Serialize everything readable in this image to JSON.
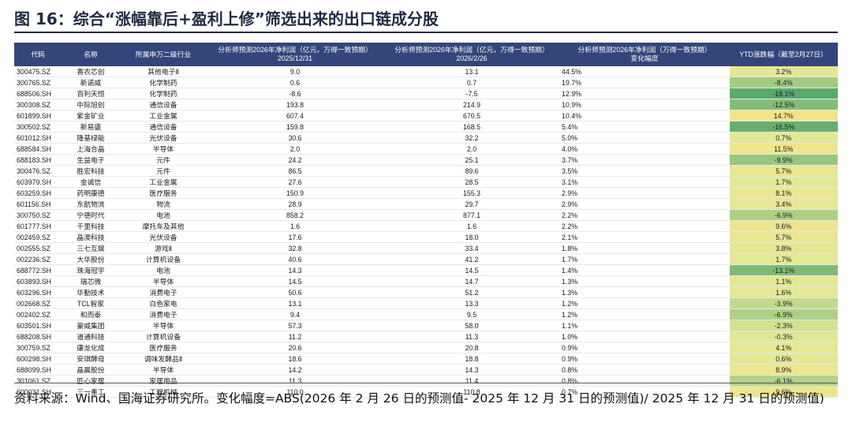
{
  "title": "图 16：综合“涨幅靠后+盈利上修”筛选出来的出口链成分股",
  "table": {
    "headers": {
      "code": "代码",
      "name": "名称",
      "industry": "所属申万二级行业",
      "np2026_1231": "分析师预测2026年净利润（亿元，万得一致预期）\n2025/12/31",
      "np2026_0226": "分析师预测2026年净利润（亿元，万得一致预期）\n2026/2/26",
      "change": "分析师预测2026年净利润（万得一致预期）\n变化幅度",
      "ytd": "YTD涨跌幅（截至2月27日）"
    },
    "rows": [
      {
        "code": "300475.SZ",
        "name": "香农芯创",
        "industry": "其他电子Ⅱ",
        "v1": "9.0",
        "v2": "13.1",
        "chg": "44.5%",
        "ytd": "3.2%",
        "ytd_val": 3.2
      },
      {
        "code": "300765.SZ",
        "name": "新诺威",
        "industry": "化学制药",
        "v1": "0.6",
        "v2": "0.7",
        "chg": "19.7%",
        "ytd": "-8.4%",
        "ytd_val": -8.4
      },
      {
        "code": "688506.SH",
        "name": "百利天恒",
        "industry": "化学制药",
        "v1": "-8.6",
        "v2": "-7.5",
        "chg": "12.9%",
        "ytd": "-18.1%",
        "ytd_val": -18.1
      },
      {
        "code": "300308.SZ",
        "name": "中际旭创",
        "industry": "通信设备",
        "v1": "193.8",
        "v2": "214.9",
        "chg": "10.9%",
        "ytd": "-12.5%",
        "ytd_val": -12.5
      },
      {
        "code": "601899.SH",
        "name": "紫金矿业",
        "industry": "工业金属",
        "v1": "607.4",
        "v2": "670.5",
        "chg": "10.4%",
        "ytd": "14.7%",
        "ytd_val": 14.7
      },
      {
        "code": "300502.SZ",
        "name": "新易盛",
        "industry": "通信设备",
        "v1": "159.8",
        "v2": "168.5",
        "chg": "5.4%",
        "ytd": "-16.5%",
        "ytd_val": -16.5
      },
      {
        "code": "601012.SH",
        "name": "隆基绿能",
        "industry": "光伏设备",
        "v1": "30.6",
        "v2": "32.2",
        "chg": "5.0%",
        "ytd": "0.7%",
        "ytd_val": 0.7
      },
      {
        "code": "688584.SH",
        "name": "上海合晶",
        "industry": "半导体",
        "v1": "2.0",
        "v2": "2.0",
        "chg": "4.0%",
        "ytd": "11.5%",
        "ytd_val": 11.5
      },
      {
        "code": "688183.SH",
        "name": "生益电子",
        "industry": "元件",
        "v1": "24.2",
        "v2": "25.1",
        "chg": "3.7%",
        "ytd": "-9.9%",
        "ytd_val": -9.9
      },
      {
        "code": "300476.SZ",
        "name": "胜宏科技",
        "industry": "元件",
        "v1": "86.5",
        "v2": "89.6",
        "chg": "3.5%",
        "ytd": "5.7%",
        "ytd_val": 5.7
      },
      {
        "code": "603979.SH",
        "name": "金诚信",
        "industry": "工业金属",
        "v1": "27.6",
        "v2": "28.5",
        "chg": "3.1%",
        "ytd": "1.7%",
        "ytd_val": 1.7
      },
      {
        "code": "603259.SH",
        "name": "药明康德",
        "industry": "医疗服务",
        "v1": "150.9",
        "v2": "155.3",
        "chg": "2.9%",
        "ytd": "8.1%",
        "ytd_val": 8.1
      },
      {
        "code": "601156.SH",
        "name": "东航物流",
        "industry": "物流",
        "v1": "28.9",
        "v2": "29.7",
        "chg": "2.9%",
        "ytd": "3.4%",
        "ytd_val": 3.4
      },
      {
        "code": "300750.SZ",
        "name": "宁德时代",
        "industry": "电池",
        "v1": "858.2",
        "v2": "877.1",
        "chg": "2.2%",
        "ytd": "-6.9%",
        "ytd_val": -6.9
      },
      {
        "code": "601777.SH",
        "name": "千里科技",
        "industry": "摩托车及其他",
        "v1": "1.6",
        "v2": "1.6",
        "chg": "2.2%",
        "ytd": "9.6%",
        "ytd_val": 9.6
      },
      {
        "code": "002459.SZ",
        "name": "晶澳科技",
        "industry": "光伏设备",
        "v1": "17.6",
        "v2": "18.0",
        "chg": "2.1%",
        "ytd": "5.7%",
        "ytd_val": 5.7
      },
      {
        "code": "002555.SZ",
        "name": "三七互娱",
        "industry": "游戏Ⅱ",
        "v1": "32.8",
        "v2": "33.4",
        "chg": "1.8%",
        "ytd": "3.8%",
        "ytd_val": 3.8
      },
      {
        "code": "002236.SZ",
        "name": "大华股份",
        "industry": "计算机设备",
        "v1": "40.6",
        "v2": "41.2",
        "chg": "1.7%",
        "ytd": "1.7%",
        "ytd_val": 1.7
      },
      {
        "code": "688772.SH",
        "name": "珠海冠宇",
        "industry": "电池",
        "v1": "14.3",
        "v2": "14.5",
        "chg": "1.4%",
        "ytd": "-13.1%",
        "ytd_val": -13.1
      },
      {
        "code": "603893.SH",
        "name": "瑞芯微",
        "industry": "半导体",
        "v1": "14.5",
        "v2": "14.7",
        "chg": "1.3%",
        "ytd": "1.1%",
        "ytd_val": 1.1
      },
      {
        "code": "603296.SH",
        "name": "华勤技术",
        "industry": "消费电子",
        "v1": "50.6",
        "v2": "51.2",
        "chg": "1.3%",
        "ytd": "1.6%",
        "ytd_val": 1.6
      },
      {
        "code": "002668.SZ",
        "name": "TCL智家",
        "industry": "白色家电",
        "v1": "13.1",
        "v2": "13.3",
        "chg": "1.2%",
        "ytd": "-3.9%",
        "ytd_val": -3.9
      },
      {
        "code": "002402.SZ",
        "name": "和而泰",
        "industry": "消费电子",
        "v1": "9.4",
        "v2": "9.5",
        "chg": "1.2%",
        "ytd": "-6.9%",
        "ytd_val": -6.9
      },
      {
        "code": "603501.SH",
        "name": "豪威集团",
        "industry": "半导体",
        "v1": "57.3",
        "v2": "58.0",
        "chg": "1.1%",
        "ytd": "-2.3%",
        "ytd_val": -2.3
      },
      {
        "code": "688208.SH",
        "name": "道通科技",
        "industry": "计算机设备",
        "v1": "11.2",
        "v2": "11.3",
        "chg": "1.0%",
        "ytd": "-0.3%",
        "ytd_val": -0.3
      },
      {
        "code": "300759.SZ",
        "name": "康龙化成",
        "industry": "医疗服务",
        "v1": "20.6",
        "v2": "20.8",
        "chg": "0.9%",
        "ytd": "4.1%",
        "ytd_val": 4.1
      },
      {
        "code": "600298.SH",
        "name": "安琪酵母",
        "industry": "调味发酵品Ⅱ",
        "v1": "18.6",
        "v2": "18.8",
        "chg": "0.9%",
        "ytd": "0.6%",
        "ytd_val": 0.6
      },
      {
        "code": "688099.SH",
        "name": "晶晨股份",
        "industry": "半导体",
        "v1": "14.2",
        "v2": "14.3",
        "chg": "0.8%",
        "ytd": "8.9%",
        "ytd_val": 8.9
      },
      {
        "code": "301061.SZ",
        "name": "匠心家居",
        "industry": "家居用品",
        "v1": "11.3",
        "v2": "11.4",
        "chg": "0.8%",
        "ytd": "-6.1%",
        "ytd_val": -6.1
      },
      {
        "code": "600031.SH",
        "name": "三一重工",
        "industry": "工程机械",
        "v1": "110.0",
        "v2": "110.8",
        "chg": "0.7%",
        "ytd": "9.6%",
        "ytd_val": 9.6
      }
    ]
  },
  "source": "资料来源：Wind、国海证券研究所。变化幅度=ABS(2026 年 2 月 26 日的预测值- 2025 年 12 月 31 日的预测值)/ 2025 年 12 月 31 日的预测值)",
  "colors": {
    "header_bg": "#33457a",
    "ytd_high": "#f3e48a",
    "ytd_low": "#5aa96c"
  }
}
